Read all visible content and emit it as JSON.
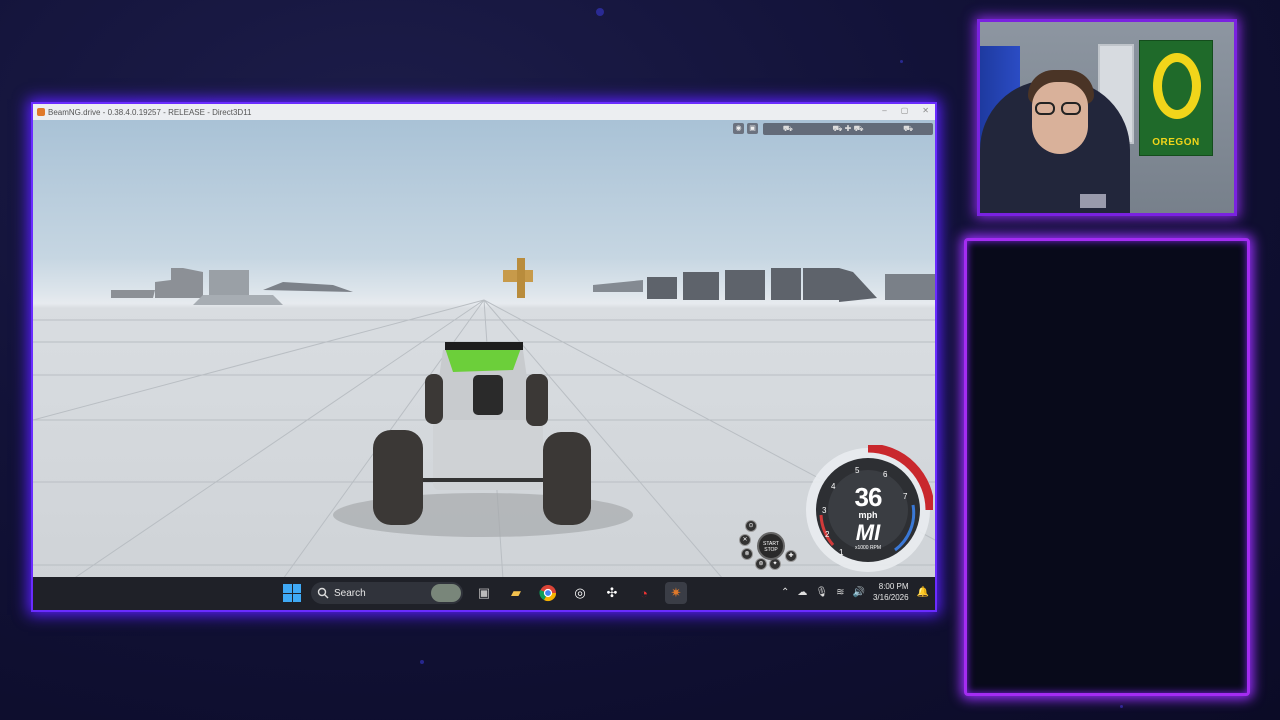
{
  "game_window": {
    "title": "BeamNG.drive - 0.38.4.0.19257 - RELEASE - Direct3D11",
    "window_controls": [
      "–",
      "▢",
      "✕"
    ]
  },
  "hud": {
    "speed": "36",
    "unit": "mph",
    "gear": "MI",
    "rpm_label": "x1000 RPM",
    "start_stop": "START STOP",
    "tachometer_ticks": [
      "1",
      "2",
      "3",
      "4",
      "5",
      "6",
      "7"
    ]
  },
  "taskbar": {
    "search_placeholder": "Search",
    "time": "8:00 PM",
    "date": "3/16/2026"
  },
  "webcam": {
    "flag_text": "OREGON"
  },
  "colors": {
    "accent_purple": "#7a22e0",
    "panel_glow": "#a42cf2",
    "flag_green": "#1f6a2a",
    "flag_yellow": "#f1d51a"
  }
}
